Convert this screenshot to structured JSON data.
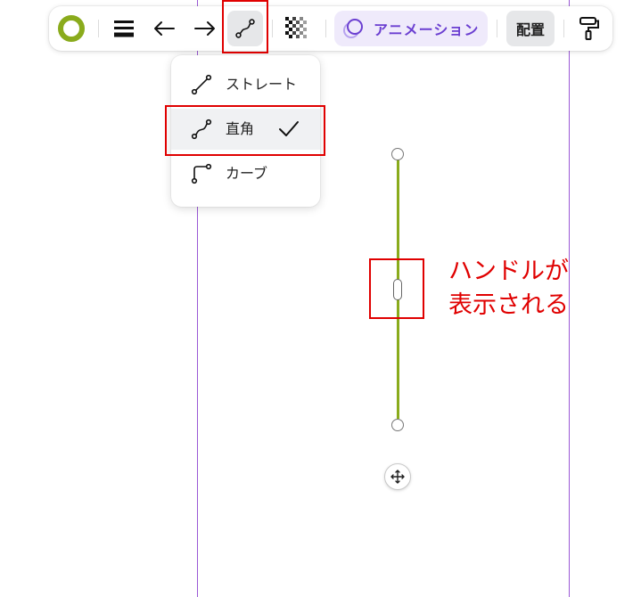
{
  "toolbar": {
    "animation_label": "アニメーション",
    "position_label": "配置"
  },
  "line_type_menu": {
    "items": [
      {
        "label": "ストレート",
        "icon": "straight-line-icon",
        "selected": false
      },
      {
        "label": "直角",
        "icon": "elbow-line-icon",
        "selected": true
      },
      {
        "label": "カーブ",
        "icon": "curve-line-icon",
        "selected": false
      }
    ]
  },
  "annotation": {
    "line1": "ハンドルが",
    "line2": "表示される"
  },
  "colors": {
    "stroke": "#8aab1c",
    "highlight": "#e00000",
    "guide": "#9b59d6",
    "accent": "#6b3fd1"
  }
}
